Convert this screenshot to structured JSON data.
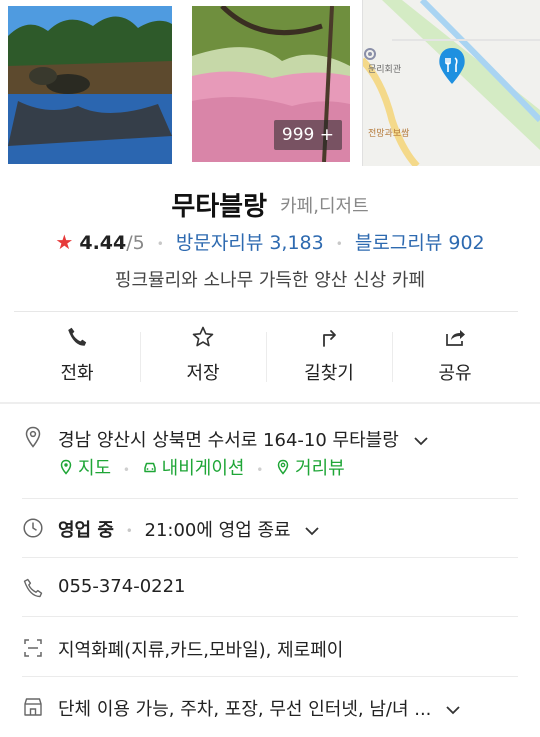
{
  "photos": {
    "count_badge": "999 +"
  },
  "map": {
    "poi_label_1": "문리회관",
    "poi_label_2": "전망과보쌈"
  },
  "place": {
    "name": "무타블랑",
    "category": "카페,디저트",
    "rating": "4.44",
    "rating_max": "/5",
    "visitor_reviews": "방문자리뷰 3,183",
    "blog_reviews": "블로그리뷰 902",
    "description": "핑크뮬리와 소나무 가득한 양산 신상 카페"
  },
  "actions": [
    {
      "label": "전화",
      "icon": "phone-icon"
    },
    {
      "label": "저장",
      "icon": "star-icon"
    },
    {
      "label": "길찾기",
      "icon": "directions-icon"
    },
    {
      "label": "공유",
      "icon": "share-icon"
    }
  ],
  "address": {
    "text": "경남 양산시 상북면 수서로 164-10 무타블랑",
    "links": [
      "지도",
      "내비게이션",
      "거리뷰"
    ]
  },
  "hours": {
    "status": "영업 중",
    "detail": "21:00에 영업 종료"
  },
  "phone": "055-374-0221",
  "payment": "지역화폐(지류,카드,모바일), 제로페이",
  "amenities": "단체 이용 가능, 주차, 포장, 무선 인터넷, 남/녀 ...",
  "colors": {
    "rating_star": "#e63a3a",
    "link_blue": "#2e6ab0",
    "link_green": "#1fa637",
    "map_pin": "#1e90e0"
  }
}
